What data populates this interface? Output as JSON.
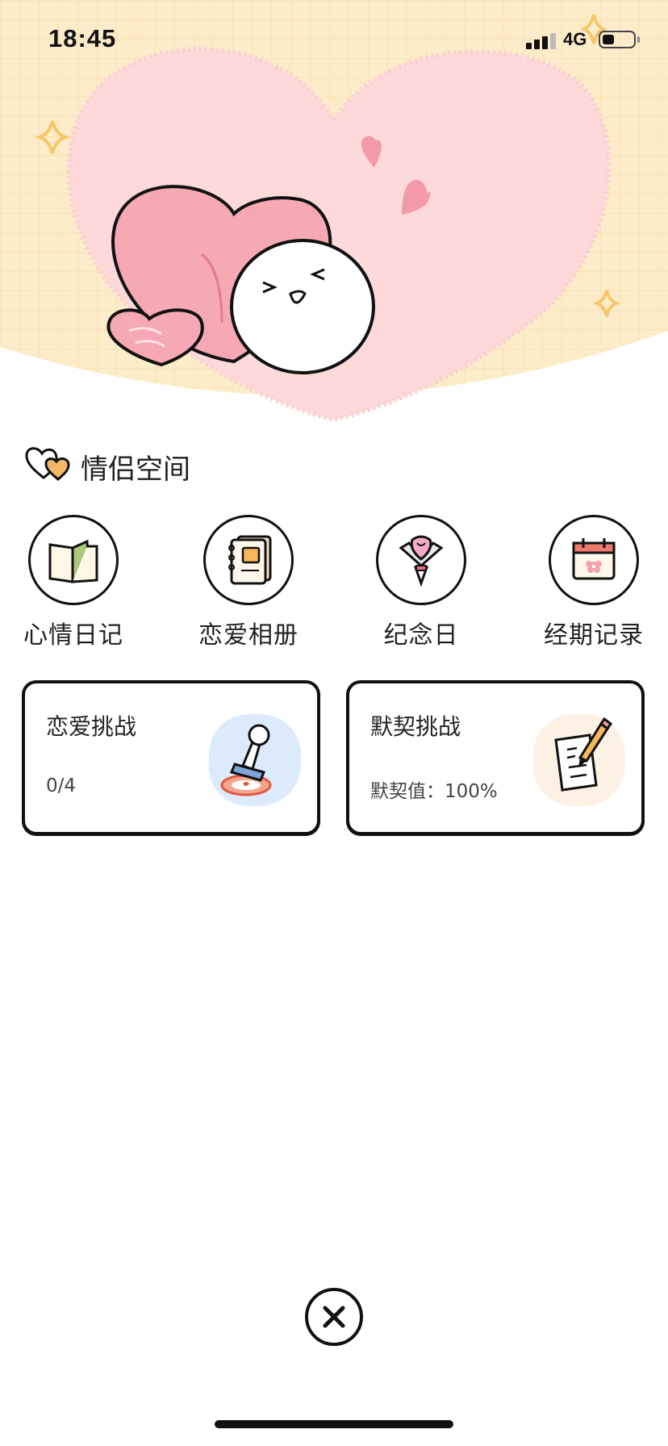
{
  "status_bar": {
    "time": "18:45",
    "network": "4G",
    "signal_bars": 4,
    "signal_active_bars": 3,
    "battery_level": 0.4
  },
  "hero": {
    "illustration": "heart-and-mochi-illustration",
    "colors": {
      "background": "#fdecc9",
      "heart": "#fdd9da",
      "accent_pink": "#f29aa5",
      "sparkle": "#f6c66a"
    }
  },
  "section": {
    "title": "情侣空间",
    "icon": "hearts-icon"
  },
  "features": [
    {
      "label": "心情日记",
      "icon": "diary-book-icon"
    },
    {
      "label": "恋爱相册",
      "icon": "photo-album-icon"
    },
    {
      "label": "纪念日",
      "icon": "bouquet-icon"
    },
    {
      "label": "经期记录",
      "icon": "calendar-icon"
    }
  ],
  "cards": [
    {
      "title": "恋爱挑战",
      "subtitle": "0/4",
      "icon": "stamp-icon",
      "art_color": "#dcebfb"
    },
    {
      "title": "默契挑战",
      "subtitle": "默契值：100%",
      "icon": "paper-pencil-icon",
      "art_color": "#fdf1e4"
    }
  ],
  "close_button": {
    "icon": "close-icon"
  }
}
